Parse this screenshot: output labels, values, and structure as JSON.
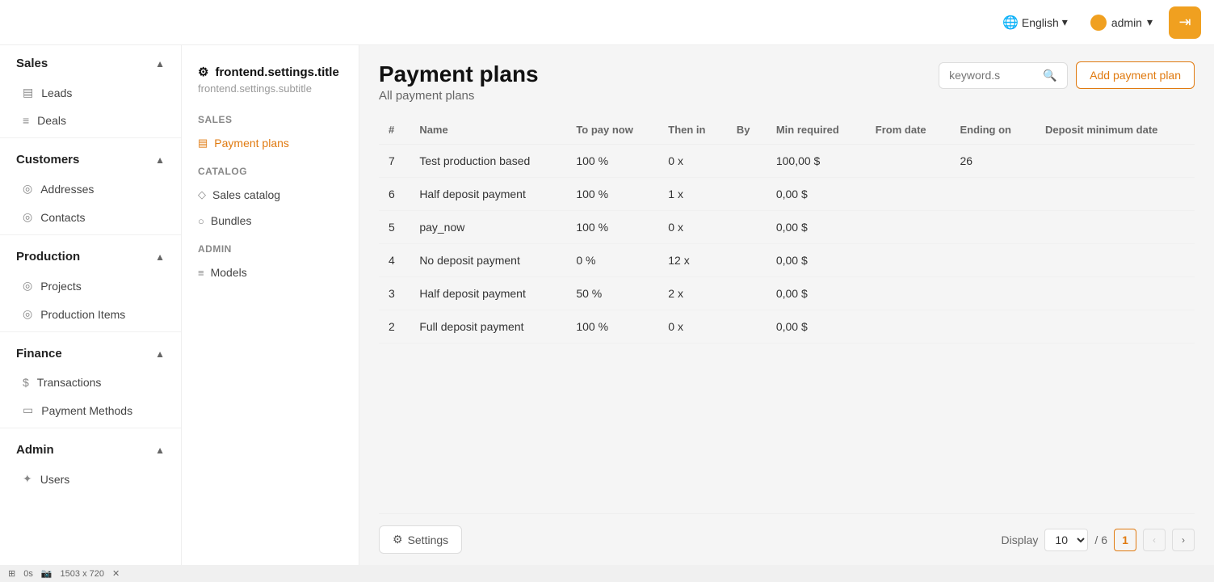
{
  "header": {
    "language": "English",
    "admin_label": "admin",
    "logout_icon": "→"
  },
  "sidebar": {
    "sections": [
      {
        "label": "Sales",
        "expanded": true,
        "items": [
          {
            "id": "leads",
            "label": "Leads",
            "icon": "▤"
          },
          {
            "id": "deals",
            "label": "Deals",
            "icon": "≡"
          }
        ]
      },
      {
        "label": "Customers",
        "expanded": true,
        "items": [
          {
            "id": "addresses",
            "label": "Addresses",
            "icon": "◎"
          },
          {
            "id": "contacts",
            "label": "Contacts",
            "icon": "◎"
          }
        ]
      },
      {
        "label": "Production",
        "expanded": true,
        "items": [
          {
            "id": "projects",
            "label": "Projects",
            "icon": "◎"
          },
          {
            "id": "production-items",
            "label": "Production Items",
            "icon": "◎"
          }
        ]
      },
      {
        "label": "Finance",
        "expanded": true,
        "items": [
          {
            "id": "transactions",
            "label": "Transactions",
            "icon": "$"
          },
          {
            "id": "payment-methods",
            "label": "Payment Methods",
            "icon": "▭"
          }
        ]
      },
      {
        "label": "Admin",
        "expanded": true,
        "items": [
          {
            "id": "users",
            "label": "Users",
            "icon": "✦"
          }
        ]
      }
    ]
  },
  "settings_sidebar": {
    "title": "frontend.settings.title",
    "subtitle": "frontend.settings.subtitle",
    "groups": [
      {
        "label": "Sales",
        "items": [
          {
            "id": "payment-plans",
            "label": "Payment plans",
            "icon": "▤",
            "active": true
          }
        ]
      },
      {
        "label": "Catalog",
        "items": [
          {
            "id": "sales-catalog",
            "label": "Sales catalog",
            "icon": "◇"
          },
          {
            "id": "bundles",
            "label": "Bundles",
            "icon": "○"
          }
        ]
      },
      {
        "label": "Admin",
        "items": [
          {
            "id": "models",
            "label": "Models",
            "icon": "≡"
          }
        ]
      }
    ]
  },
  "page": {
    "title": "Payment plans",
    "subtitle": "All payment plans",
    "search_placeholder": "keyword.s",
    "add_button_label": "Add payment plan"
  },
  "table": {
    "columns": [
      "#",
      "Name",
      "To pay now",
      "Then in",
      "By",
      "Min required",
      "From date",
      "Ending on",
      "Deposit minimum date"
    ],
    "rows": [
      {
        "id": 7,
        "name": "Test production based",
        "to_pay_now": "100 %",
        "then_in": "0 x",
        "by": "",
        "min_required": "100,00 $",
        "from_date": "",
        "ending_on": "26",
        "deposit_min_date": ""
      },
      {
        "id": 6,
        "name": "Half deposit payment",
        "to_pay_now": "100 %",
        "then_in": "1 x",
        "by": "",
        "min_required": "0,00 $",
        "from_date": "",
        "ending_on": "",
        "deposit_min_date": ""
      },
      {
        "id": 5,
        "name": "pay_now",
        "to_pay_now": "100 %",
        "then_in": "0 x",
        "by": "",
        "min_required": "0,00 $",
        "from_date": "",
        "ending_on": "",
        "deposit_min_date": ""
      },
      {
        "id": 4,
        "name": "No deposit payment",
        "to_pay_now": "0 %",
        "then_in": "12 x",
        "by": "",
        "min_required": "0,00 $",
        "from_date": "",
        "ending_on": "",
        "deposit_min_date": ""
      },
      {
        "id": 3,
        "name": "Half deposit payment",
        "to_pay_now": "50 %",
        "then_in": "2 x",
        "by": "",
        "min_required": "0,00 $",
        "from_date": "",
        "ending_on": "",
        "deposit_min_date": ""
      },
      {
        "id": 2,
        "name": "Full deposit payment",
        "to_pay_now": "100 %",
        "then_in": "0 x",
        "by": "",
        "min_required": "0,00 $",
        "from_date": "",
        "ending_on": "",
        "deposit_min_date": ""
      }
    ]
  },
  "footer": {
    "settings_label": "Settings",
    "display_label": "Display",
    "display_value": "10",
    "total_label": "/ 6",
    "current_page": "1"
  },
  "statusbar": {
    "time": "0s",
    "dimensions": "1503 x 720"
  }
}
